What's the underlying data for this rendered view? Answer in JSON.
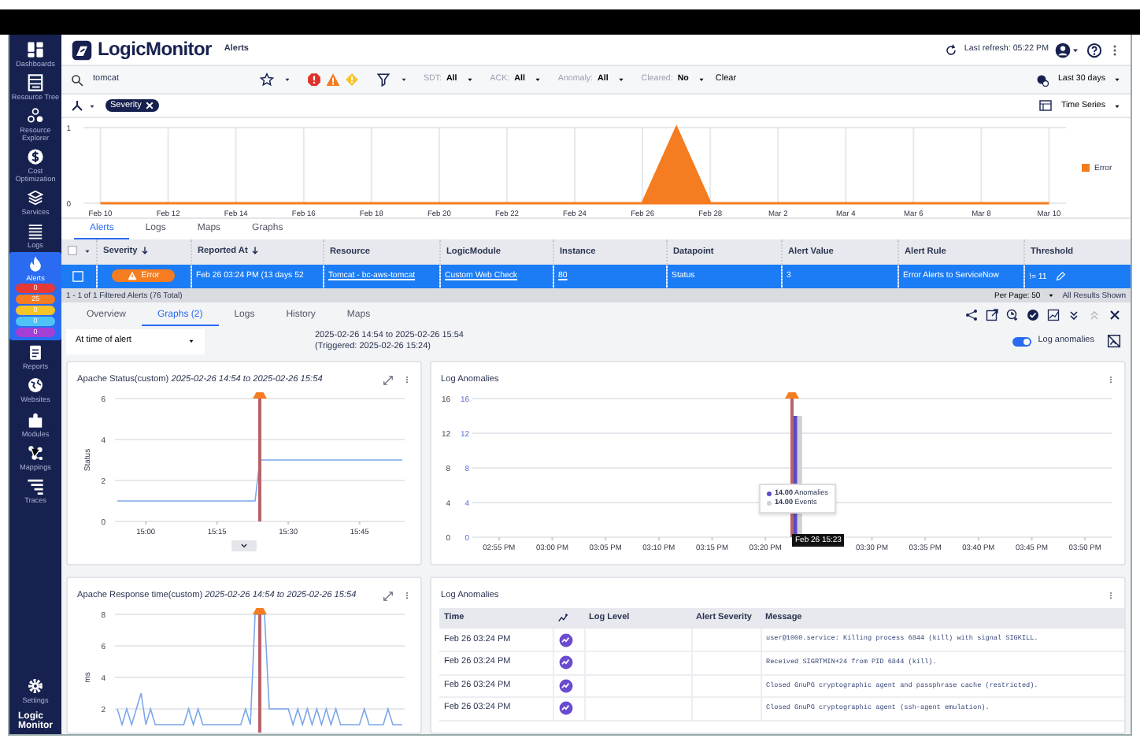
{
  "sidebar": {
    "items": [
      {
        "label": "Dashboards",
        "selected": false
      },
      {
        "label": "Resource Tree",
        "selected": false
      },
      {
        "label": "Resource Explorer",
        "selected": false
      },
      {
        "label": "Cost Optimization",
        "selected": false
      },
      {
        "label": "Services",
        "selected": false
      },
      {
        "label": "Logs",
        "selected": false
      },
      {
        "label": "Alerts",
        "selected": true,
        "counts": [
          {
            "value": "0",
            "color": "#e53935"
          },
          {
            "value": "25",
            "color": "#f57c20"
          },
          {
            "value": "0",
            "color": "#f6c328"
          },
          {
            "value": "0",
            "color": "#4fc3f7"
          },
          {
            "value": "0",
            "color": "#a43fd6"
          }
        ]
      },
      {
        "label": "Reports",
        "selected": false
      },
      {
        "label": "Websites",
        "selected": false
      },
      {
        "label": "Modules",
        "selected": false
      },
      {
        "label": "Mappings",
        "selected": false
      },
      {
        "label": "Traces",
        "selected": false
      }
    ],
    "footer": [
      {
        "label": "Settings",
        "selected": false
      }
    ],
    "logo_lines": [
      "Logic",
      "Monitor"
    ]
  },
  "header": {
    "logo": "LogicMonitor",
    "page": "Alerts",
    "last_refresh": "Last refresh: 05:22 PM"
  },
  "filters": {
    "search": "tomcat",
    "severity": [
      {
        "kind": "critical",
        "color": "#e0312b"
      },
      {
        "kind": "error",
        "color": "#f57c20"
      },
      {
        "kind": "warning",
        "color": "#f6c328"
      }
    ],
    "facets": [
      {
        "label": "SDT:",
        "value": "All"
      },
      {
        "label": "ACK:",
        "value": "All"
      },
      {
        "label": "Anomaly:",
        "value": "All"
      },
      {
        "label": "Cleared:",
        "value": "No"
      }
    ],
    "clear": "Clear",
    "range": "Last 30 days"
  },
  "chips": {
    "items": [
      {
        "label": "Severity"
      }
    ],
    "view": "Time Series"
  },
  "overview": {
    "chart_data": {
      "type": "area",
      "categories": [
        "Feb 10",
        null,
        "Feb 12",
        null,
        "Feb 14",
        null,
        "Feb 16",
        null,
        "Feb 18",
        null,
        "Feb 20",
        null,
        "Feb 22",
        null,
        "Feb 24",
        null,
        "Feb 26",
        null,
        "Feb 28",
        null,
        "Mar 2",
        null,
        "Mar 4",
        null,
        "Mar 6",
        null,
        "Mar 8",
        null,
        "Mar 10"
      ],
      "series": [
        {
          "name": "Error",
          "color": "#f57c20",
          "values": [
            0,
            0,
            0,
            0,
            0,
            0,
            0,
            0,
            0,
            0,
            0,
            0,
            0,
            0,
            0,
            0,
            0,
            1,
            0,
            0,
            0,
            0,
            0,
            0,
            0,
            0,
            0,
            0,
            0
          ]
        }
      ],
      "grid": true,
      "ylim": [
        0,
        1
      ],
      "yticks": [
        0,
        1
      ]
    }
  },
  "tabs": [
    {
      "label": "Alerts",
      "selected": true
    },
    {
      "label": "Logs",
      "selected": false
    },
    {
      "label": "Maps",
      "selected": false
    },
    {
      "label": "Graphs",
      "selected": false
    }
  ],
  "table": {
    "select_all": {
      "checked": false
    },
    "columns": [
      {
        "label": "Severity",
        "sorted": true
      },
      {
        "label": "Reported At",
        "sorted": true
      },
      {
        "label": "Resource",
        "sorted": false
      },
      {
        "label": "LogicModule",
        "sorted": false
      },
      {
        "label": "Instance",
        "sorted": false
      },
      {
        "label": "Datapoint",
        "sorted": false
      },
      {
        "label": "Alert Value",
        "sorted": false
      },
      {
        "label": "Alert Rule",
        "sorted": false
      },
      {
        "label": "Threshold",
        "sorted": false
      }
    ],
    "rows": [
      {
        "selected": true,
        "checked": false,
        "cells": [
          {
            "kind": "badge",
            "text": "Error"
          },
          {
            "kind": "text",
            "text": "Feb 26 03:24 PM  (13 days 52"
          },
          {
            "kind": "link",
            "text": "Tomcat - bc-aws-tomcat"
          },
          {
            "kind": "link",
            "text": "Custom Web Check"
          },
          {
            "kind": "link",
            "text": "80"
          },
          {
            "kind": "text",
            "text": "Status"
          },
          {
            "kind": "text",
            "text": "3"
          },
          {
            "kind": "text",
            "text": "Error Alerts to ServiceNow"
          },
          {
            "kind": "edit",
            "text": "!= 11"
          }
        ]
      }
    ]
  },
  "status_bar": {
    "summary": "1 - 1 of 1 Filtered Alerts (76 Total)",
    "per_page": "Per Page: 50",
    "shown": "All Results Shown"
  },
  "detail": {
    "tabs": [
      {
        "label": "Overview",
        "selected": false
      },
      {
        "label": "Graphs (2)",
        "selected": true
      },
      {
        "label": "Logs",
        "selected": false
      },
      {
        "label": "History",
        "selected": false
      },
      {
        "label": "Maps",
        "selected": false
      }
    ],
    "range_select": "At time of alert",
    "range": "2025-02-26 14:54 to 2025-02-26 15:54",
    "triggered": "(Triggered: 2025-02-26 15:24)",
    "toggle": {
      "label": "Log anomalies",
      "on": true
    },
    "panels": [
      {
        "kind": "line",
        "title": "Apache Status(custom) *2025-02-26 14:54 to 2025-02-26 15:54*",
        "chart_data": {
          "type": "line",
          "ylabel": "Status",
          "categories": [
            null,
            null,
            null,
            null,
            null,
            null,
            "15:00",
            null,
            null,
            null,
            null,
            null,
            null,
            null,
            null,
            null,
            null,
            null,
            null,
            null,
            null,
            "15:15",
            null,
            null,
            null,
            null,
            null,
            null,
            null,
            null,
            null,
            null,
            null,
            null,
            null,
            null,
            "15:30",
            null,
            null,
            null,
            null,
            null,
            null,
            null,
            null,
            null,
            null,
            null,
            null,
            null,
            null,
            "15:45",
            null,
            null,
            null,
            null,
            null,
            null,
            null,
            null,
            null
          ],
          "series": [
            {
              "color": "#7aa7e8",
              "values": [
                1,
                1,
                1,
                1,
                1,
                1,
                1,
                1,
                1,
                1,
                1,
                1,
                1,
                1,
                1,
                1,
                1,
                1,
                1,
                1,
                1,
                1,
                1,
                1,
                1,
                1,
                1,
                1,
                1,
                1,
                3,
                3,
                3,
                3,
                3,
                3,
                3,
                3,
                3,
                3,
                3,
                3,
                3,
                3,
                3,
                3,
                3,
                3,
                3,
                3,
                3,
                3,
                3,
                3,
                3,
                3,
                3,
                3,
                3,
                3,
                3
              ]
            }
          ],
          "grid": true,
          "ylim": [
            0,
            6
          ],
          "yticks": [
            0,
            2,
            4,
            6
          ]
        }
      },
      {
        "kind": "bars",
        "title": "Log Anomalies",
        "chart_data": {
          "type": "bar",
          "categories": [
            null,
            null,
            "02:55 PM",
            null,
            null,
            null,
            null,
            "03:00 PM",
            null,
            null,
            null,
            null,
            "03:05 PM",
            null,
            null,
            null,
            null,
            "03:10 PM",
            null,
            null,
            null,
            null,
            "03:15 PM",
            null,
            null,
            null,
            null,
            "03:20 PM",
            null,
            null,
            null,
            null,
            null,
            null,
            null,
            null,
            null,
            "03:30 PM",
            null,
            null,
            null,
            null,
            "03:35 PM",
            null,
            null,
            null,
            null,
            "03:40 PM",
            null,
            null,
            null,
            null,
            "03:45 PM",
            null,
            null,
            null,
            null,
            "03:50 PM",
            null,
            null
          ],
          "series": [
            {
              "name": "Anomalies",
              "color": "#5b4bc4",
              "values": [
                null,
                null,
                null,
                null,
                null,
                null,
                null,
                null,
                null,
                null,
                null,
                null,
                null,
                null,
                null,
                null,
                null,
                null,
                null,
                null,
                null,
                null,
                null,
                null,
                null,
                null,
                null,
                null,
                null,
                null,
                14,
                null,
                null,
                null,
                null,
                null,
                null,
                null,
                null,
                null,
                null,
                null,
                null,
                null,
                null,
                null,
                null,
                null,
                null,
                null,
                null,
                null,
                null,
                null,
                null,
                null,
                null,
                null,
                null,
                null
              ]
            },
            {
              "name": "Events",
              "color": "#cfcfd6",
              "values": [
                null,
                null,
                null,
                null,
                null,
                null,
                null,
                null,
                null,
                null,
                null,
                null,
                null,
                null,
                null,
                null,
                null,
                null,
                null,
                null,
                null,
                null,
                null,
                null,
                null,
                null,
                null,
                null,
                null,
                null,
                14,
                null,
                null,
                null,
                null,
                null,
                null,
                null,
                null,
                null,
                null,
                null,
                null,
                null,
                null,
                null,
                null,
                null,
                null,
                null,
                null,
                null,
                null,
                null,
                null,
                null,
                null,
                null,
                null,
                null
              ]
            }
          ],
          "grid": true,
          "ylim": [
            0,
            16
          ],
          "yticks": [
            0,
            4,
            8,
            12,
            16
          ],
          "y2lim": [
            0,
            16
          ],
          "y2ticks": [
            0,
            4,
            8,
            12,
            16
          ]
        },
        "tooltip": [
          "14.00",
          "14.00"
        ],
        "crosshair": "Feb 26 15:23"
      },
      {
        "kind": "line",
        "title": "Apache Response time(custom) *2025-02-26 14:54 to 2025-02-26 15:54*",
        "chart_data": {
          "type": "line",
          "ylabel": "ms",
          "series": [
            {
              "color": "#7aa7e8",
              "values": [
                2,
                1,
                2,
                1,
                2,
                3,
                1,
                2,
                1,
                1,
                1,
                1,
                1,
                1,
                1,
                2,
                1,
                2,
                1,
                1,
                1,
                1,
                1,
                1,
                1,
                1,
                1,
                2,
                1,
                8,
                8,
                8,
                2,
                2,
                2,
                2,
                2,
                1,
                2,
                1,
                2,
                1,
                2,
                1,
                2,
                1,
                2,
                1,
                1,
                1,
                1,
                1,
                2,
                1,
                1,
                1,
                1,
                2,
                1,
                1,
                1
              ]
            }
          ],
          "grid": true,
          "ylim": [
            0,
            8
          ],
          "yticks": [
            2,
            4,
            6,
            8
          ]
        }
      },
      {
        "kind": "log_table",
        "title": "Log Anomalies",
        "columns": [
          "Time",
          "Log Level",
          "Alert Severity",
          "Message"
        ],
        "rows": [
          {
            "time": "Feb 26 03:24 PM",
            "message": "user@1000.service: Killing process 6844 (kill) with signal SIGKILL."
          },
          {
            "time": "Feb 26 03:24 PM",
            "message": "Received SIGRTMIN+24 from PID 6844 (kill)."
          },
          {
            "time": "Feb 26 03:24 PM",
            "message": "Closed GnuPG cryptographic agent and passphrase cache (restricted)."
          },
          {
            "time": "Feb 26 03:24 PM",
            "message": "Closed GnuPG cryptographic agent (ssh-agent emulation)."
          }
        ]
      }
    ]
  }
}
